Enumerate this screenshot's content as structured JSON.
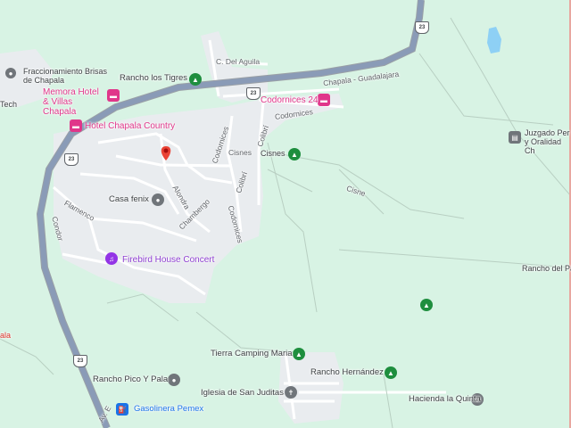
{
  "map": {
    "labels": {
      "fraccionamiento": "Fraccionamiento Brisas de Chapala",
      "tech": "Tech",
      "memora": "Memora Hotel & Villas Chapala",
      "hotel_country": "Hotel Chapala Country",
      "rancho_tigres": "Rancho los Tigres",
      "c_del_aguila": "C. Del Aguila",
      "chapala_guadalajara": "Chapala - Guadalajara",
      "codornices_24": "Codornices 24",
      "codornices_road": "Codornices",
      "codornices_vertical": "Codornices",
      "codornices_lower": "Codornices",
      "colibri": "Colibrí",
      "colibri_2": "Colibrí",
      "cisnes_street": "Cisnes",
      "cisnes_poi": "Cisnes",
      "cisne": "Cisne",
      "casa_fenix": "Casa fenix",
      "alondra": "Alondra",
      "chambergo": "Chambergo",
      "flamenco": "Flamenco",
      "condor": "Condor",
      "firebird": "Firebird House Concert",
      "juzgado": "Juzgado Per y Oralidad Ch",
      "rancho_del_pa": "Rancho del Pa",
      "tierra_camping": "Tierra Camping Maria",
      "rancho_hernandez": "Rancho Hernández",
      "rancho_pico": "Rancho Pico Y Pala",
      "iglesia": "Iglesia de San Juditas",
      "hacienda": "Hacienda la Quinta",
      "gasolinera": "Gasolinera Pemex",
      "chapala_edge": "ala",
      "av_e": "Av. E"
    },
    "shields": {
      "s1": "23",
      "s2": "23",
      "s3": "23",
      "s4": "23"
    }
  }
}
